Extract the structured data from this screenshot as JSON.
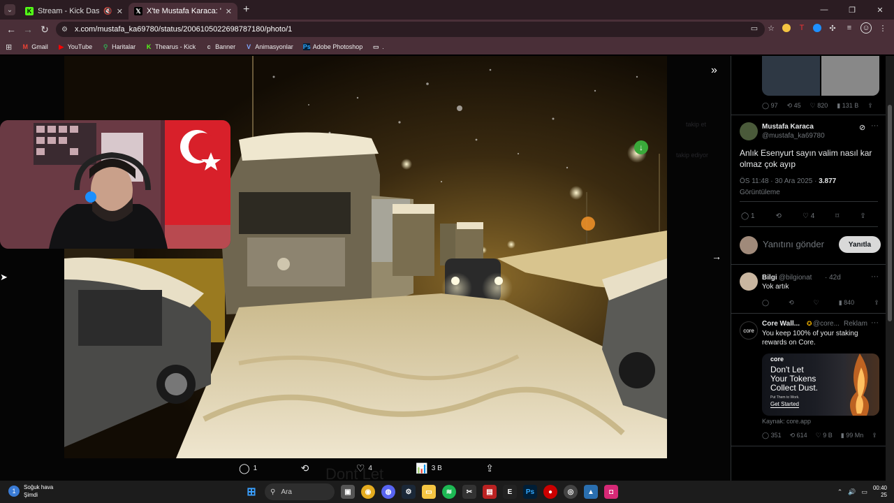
{
  "browser": {
    "tabs": [
      {
        "title": "Stream - Kick Dashboard",
        "icon": "kick-icon",
        "muted": true
      },
      {
        "title": "X'te Mustafa Karaca: \"@bosuna",
        "icon": "x-icon"
      }
    ],
    "url": "x.com/mustafa_ka69780/status/2006105022698787180/photo/1",
    "bookmarks": [
      "Gmail",
      "YouTube",
      "Haritalar",
      "Thearus - Kick",
      "Banner",
      "Animasyonlar",
      "Adobe Photoshop",
      "."
    ]
  },
  "viewer": {
    "bottom_actions": {
      "replies": "1",
      "reposts": "",
      "likes": "4",
      "views": "3 B"
    },
    "ghost_text": [
      "takip et",
      "takip ediyor",
      "Dont Let"
    ]
  },
  "panel": {
    "prev_stats": {
      "replies": "97",
      "reposts": "45",
      "likes": "820",
      "views": "131 B"
    },
    "main_tweet": {
      "name": "Mustafa Karaca",
      "handle": "@mustafa_ka69780",
      "text_line1": "Anlık Esenyurt sayın valim nasıl kar",
      "text_line2": "olmaz çok ayıp",
      "meta_time": "ÖS 11:48 · 30 Ara 2025 · ",
      "meta_views": "3.877",
      "meta_label": "Görüntüleme",
      "replies": "1",
      "likes": "4"
    },
    "reply_box": {
      "placeholder": "Yanıtını gönder",
      "button": "Yanıtla"
    },
    "reply": {
      "name": "Bilgi",
      "handle": "@bilgionat",
      "age": "· 42d",
      "text": "Yok artık",
      "views": "840"
    },
    "ad": {
      "name": "Core Wall...",
      "handle": "@core...",
      "label": "Reklam",
      "text_line1": "You keep 100% of your staking",
      "text_line2": "rewards on Core.",
      "card_brand": "core",
      "card_headline": [
        "Don't Let",
        "Your Tokens",
        "Collect Dust."
      ],
      "card_sub": "Put Them to Work.",
      "card_cta": "Get Started",
      "source": "Kaynak: core.app",
      "stats": {
        "replies": "351",
        "reposts": "614",
        "likes": "9 B",
        "views": "99 Mn"
      }
    }
  },
  "taskbar": {
    "weather_title": "Soğuk hava",
    "weather_sub": "Şimdi",
    "search": "Ara",
    "time": "00:40",
    "date": "25"
  },
  "colors": {
    "chrome_dark": "#2b1c22",
    "chrome_mid": "#4a2f38",
    "x_bg": "#000000",
    "accent_green": "#3aa93a"
  }
}
